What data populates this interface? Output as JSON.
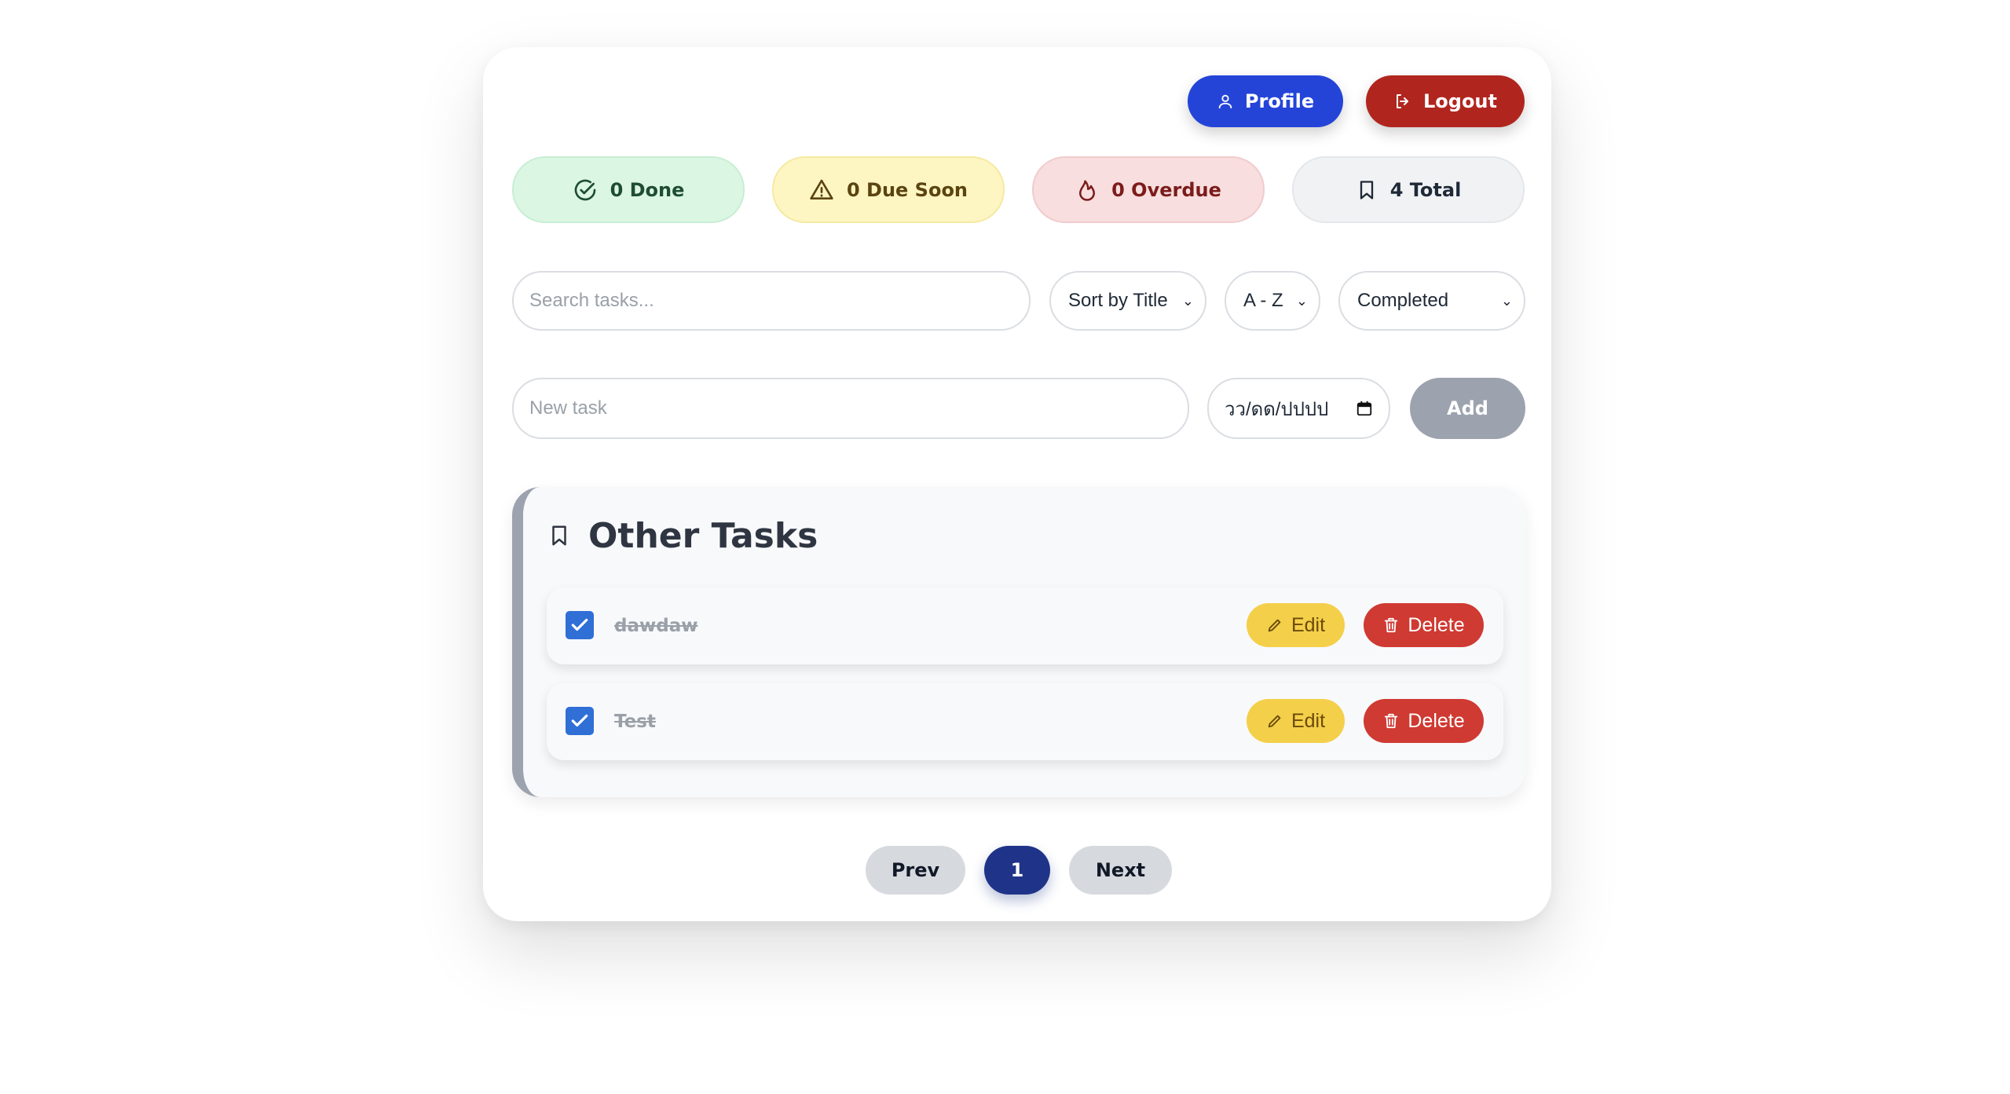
{
  "header": {
    "profile_label": "Profile",
    "logout_label": "Logout"
  },
  "stats": {
    "done": "0 Done",
    "due_soon": "0 Due Soon",
    "overdue": "0 Overdue",
    "total": "4 Total"
  },
  "filters": {
    "search_placeholder": "Search tasks...",
    "sort_value": "Sort by Title",
    "order_value": "A - Z",
    "status_value": "Completed"
  },
  "new_task": {
    "placeholder": "New task",
    "date_placeholder": "วว/ดด/ปปปป",
    "add_label": "Add"
  },
  "section": {
    "title": "Other Tasks",
    "tasks": [
      {
        "title": "dawdaw",
        "completed": true
      },
      {
        "title": "Test",
        "completed": true
      }
    ],
    "edit_label": "Edit",
    "delete_label": "Delete"
  },
  "pagination": {
    "prev_label": "Prev",
    "current_page": "1",
    "next_label": "Next"
  },
  "colors": {
    "primary": "#2444d8",
    "danger": "#b0261e",
    "warning": "#f4cf4a",
    "checkbox": "#2f6fd6",
    "page_active": "#1f3488"
  }
}
